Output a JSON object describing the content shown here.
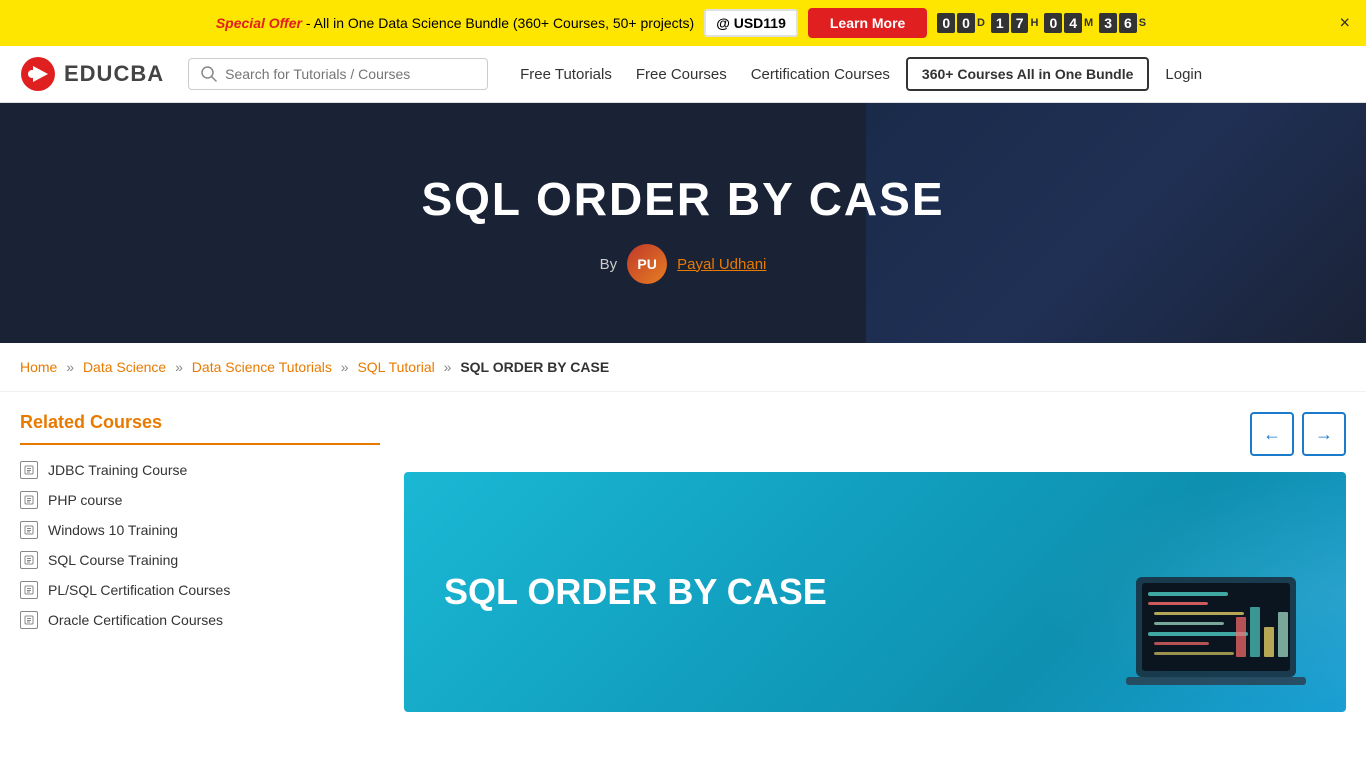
{
  "banner": {
    "special_label": "Special Offer",
    "text": " - All in One Data Science Bundle (360+ Courses, 50+ projects)",
    "at_text": "@ USD119",
    "learn_more": "Learn More",
    "timer": {
      "days_tens": "0",
      "days_units": "0",
      "days_label": "D",
      "hours_tens": "1",
      "hours_units": "7",
      "hours_label": "H",
      "mins_tens": "0",
      "mins_units": "4",
      "mins_label": "M",
      "secs_tens": "3",
      "secs_units": "6",
      "secs_label": "S"
    },
    "close_label": "×"
  },
  "navbar": {
    "logo_text": "EDUCBA",
    "search_placeholder": "Search for Tutorials / Courses",
    "nav": {
      "free_tutorials": "Free Tutorials",
      "free_courses": "Free Courses",
      "certification_courses": "Certification Courses",
      "bundle_btn": "360+ Courses All in One Bundle",
      "login": "Login"
    }
  },
  "hero": {
    "title": "SQL ORDER BY CASE",
    "by_label": "By",
    "author_name": "Payal Udhani",
    "author_initials": "PU"
  },
  "breadcrumb": {
    "home": "Home",
    "data_science": "Data Science",
    "ds_tutorials": "Data Science Tutorials",
    "sql_tutorial": "SQL Tutorial",
    "current": "SQL ORDER BY CASE",
    "sep": "»"
  },
  "sidebar": {
    "related_title": "Related Courses",
    "courses": [
      {
        "name": "JDBC Training Course"
      },
      {
        "name": "PHP course"
      },
      {
        "name": "Windows 10 Training"
      },
      {
        "name": "SQL Course Training"
      },
      {
        "name": "PL/SQL Certification Courses"
      },
      {
        "name": "Oracle Certification Courses"
      }
    ]
  },
  "carousel": {
    "prev_label": "←",
    "next_label": "→"
  },
  "featured": {
    "title": "SQL ORDER BY CASE"
  }
}
